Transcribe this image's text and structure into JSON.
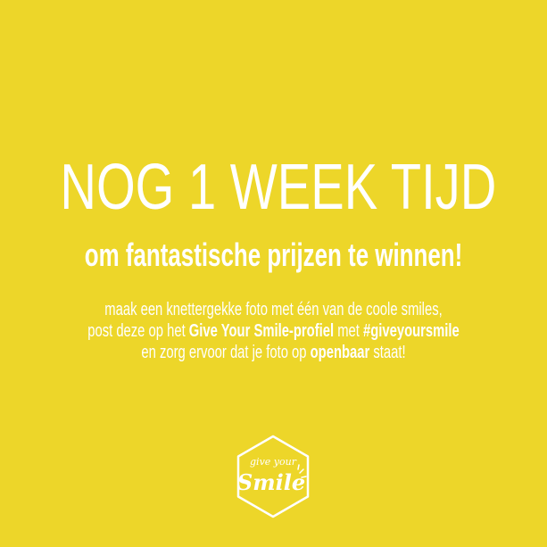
{
  "headline": "NOG 1 WEEK TIJD",
  "subheadline": "om fantastische prijzen te winnen!",
  "body": {
    "line1": "maak een knettergekke foto met één van de coole smiles,",
    "line2_a": "post deze op het ",
    "line2_b": "Give Your Smile-profiel",
    "line2_c": " met ",
    "line2_d": "#giveyoursmile",
    "line3_a": "en zorg ervoor dat je foto op ",
    "line3_b": "openbaar",
    "line3_c": " staat!"
  },
  "logo": {
    "top_text": "give your",
    "main_text": "Smile"
  },
  "colors": {
    "background": "#EDD629",
    "text": "#FFFFFF"
  }
}
